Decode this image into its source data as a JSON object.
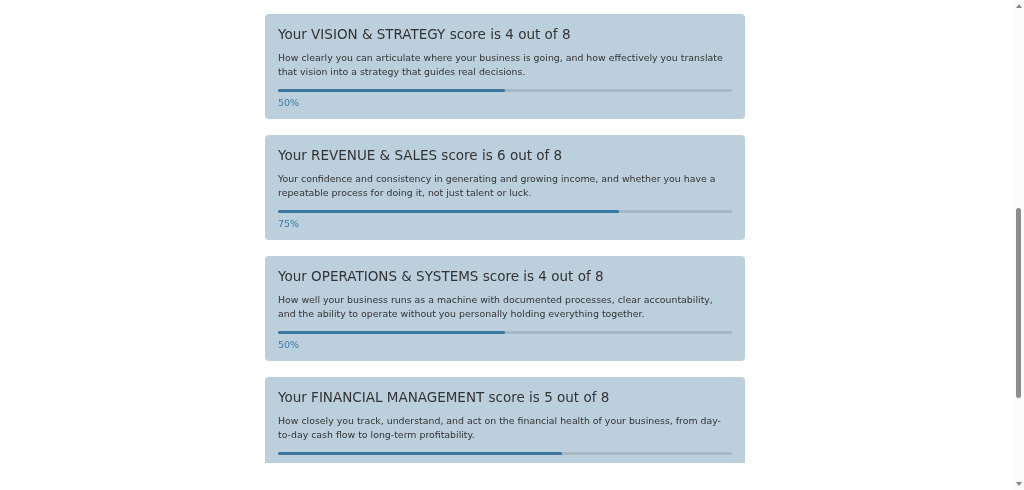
{
  "cards": [
    {
      "title": "Your VISION & STRATEGY score is 4 out of 8",
      "description": "How clearly you can articulate where your business is going, and how effectively you translate that vision into a strategy that guides real decisions.",
      "level": 0.5,
      "reading": "50%"
    },
    {
      "title": "Your REVENUE & SALES score is 6 out of 8",
      "description": "Your confidence and consistency in generating and growing income, and whether you have a repeatable process for doing it, not just talent or luck.",
      "level": 0.75,
      "reading": "75%"
    },
    {
      "title": "Your OPERATIONS & SYSTEMS score is 4 out of 8",
      "description": "How well your business runs as a machine with documented processes, clear accountability, and the ability to operate without you personally holding everything together.",
      "level": 0.5,
      "reading": "50%"
    },
    {
      "title": "Your FINANCIAL MANAGEMENT score is 5 out of 8",
      "description": "How closely you track, understand, and act on the financial health of your business, from day-to-day cash flow to long-term profitability.",
      "level": 0.625
    }
  ]
}
